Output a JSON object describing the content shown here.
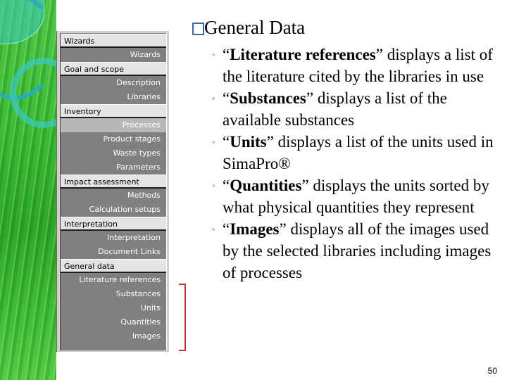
{
  "slide": {
    "title": "General Data",
    "title_icon": "square-bullet-icon",
    "bullets": [
      {
        "open_quote": "“",
        "term": "Literature references",
        "close_quote": "”",
        "text": " displays a list of the literature cited by the libraries in use"
      },
      {
        "open_quote": "“",
        "term": "Substances",
        "close_quote": "”",
        "text": " displays a list of the available substances"
      },
      {
        "open_quote": "“",
        "term": "Units",
        "close_quote": "”",
        "text": " displays a list of the units used in SimaPro®"
      },
      {
        "open_quote": "“",
        "term": "Quantities",
        "close_quote": "”",
        "text": " displays the units sorted by what physical quantities they represent"
      },
      {
        "open_quote": "“",
        "term": "Images",
        "close_quote": "”",
        "text": " displays all of the images used by the selected libraries including images of processes"
      }
    ],
    "bullet_glyph": "◦",
    "page_number": "50"
  },
  "nav": {
    "sections": [
      {
        "header": "Wizards",
        "items": [
          "Wizards"
        ]
      },
      {
        "header": "Goal and scope",
        "items": [
          "Description",
          "Libraries"
        ]
      },
      {
        "header": "Inventory",
        "items": [
          "Processes",
          "Product stages",
          "Waste types",
          "Parameters"
        ]
      },
      {
        "header": "Impact assessment",
        "items": [
          "Methods",
          "Calculation setups"
        ]
      },
      {
        "header": "Interpretation",
        "items": [
          "Interpretation",
          "Document Links"
        ]
      },
      {
        "header": "General data",
        "items": [
          "Literature references",
          "Substances",
          "Units",
          "Quantities",
          "Images"
        ]
      }
    ],
    "active_item": "Processes",
    "highlight_color": "#c0303a"
  }
}
